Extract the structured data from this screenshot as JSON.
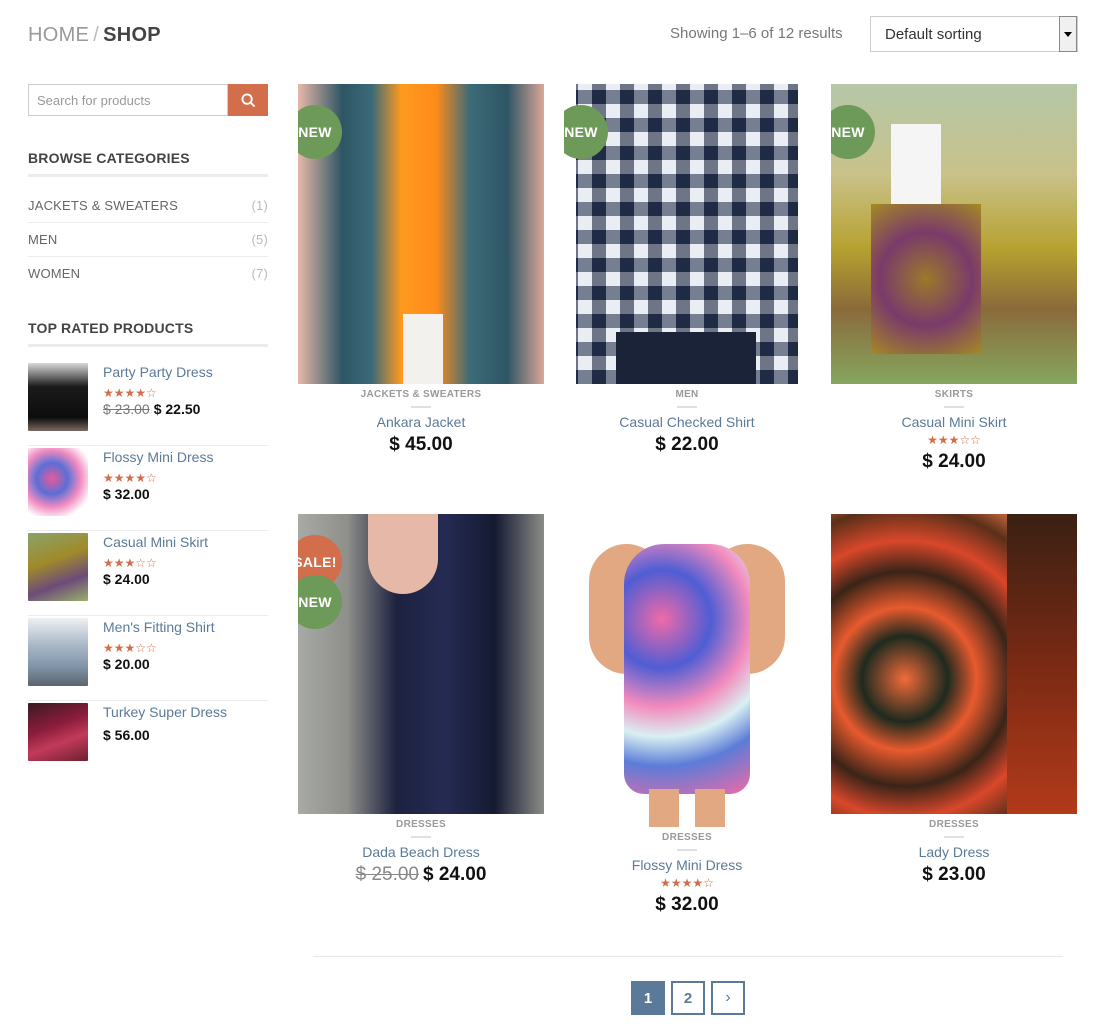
{
  "breadcrumb": {
    "home": "HOME",
    "separator": "/",
    "current": "SHOP"
  },
  "result_count": "Showing 1–6 of 12 results",
  "sorting": {
    "selected": "Default sorting"
  },
  "search": {
    "placeholder": "Search for products"
  },
  "categories": {
    "title": "BROWSE CATEGORIES",
    "items": [
      {
        "label": "JACKETS & SWEATERS",
        "count": "(1)"
      },
      {
        "label": "MEN",
        "count": "(5)"
      },
      {
        "label": "WOMEN",
        "count": "(7)"
      }
    ]
  },
  "top_rated": {
    "title": "TOP RATED PRODUCTS",
    "items": [
      {
        "name": "Party Party Dress",
        "stars": "★★★★☆",
        "rating": 4,
        "old_price": "$ 23.00",
        "price": "$ 22.50"
      },
      {
        "name": "Flossy Mini Dress",
        "stars": "★★★★☆",
        "rating": 4,
        "old_price": "",
        "price": "$ 32.00"
      },
      {
        "name": "Casual Mini Skirt",
        "stars": "★★★☆☆",
        "rating": 3,
        "old_price": "",
        "price": "$ 24.00"
      },
      {
        "name": "Men's Fitting Shirt",
        "stars": "★★★☆☆",
        "rating": 3,
        "old_price": "",
        "price": "$ 20.00"
      },
      {
        "name": "Turkey Super Dress",
        "stars": "",
        "rating": 0,
        "old_price": "",
        "price": "$ 56.00"
      }
    ]
  },
  "products": [
    {
      "category": "JACKETS & SWEATERS",
      "name": "Ankara Jacket",
      "stars": "",
      "old_price": "",
      "price": "$ 45.00",
      "badges": [
        "NEW"
      ]
    },
    {
      "category": "MEN",
      "name": "Casual Checked Shirt",
      "stars": "",
      "old_price": "",
      "price": "$ 22.00",
      "badges": [
        "NEW"
      ]
    },
    {
      "category": "SKIRTS",
      "name": "Casual Mini Skirt",
      "stars": "★★★☆☆",
      "rating": 3,
      "old_price": "",
      "price": "$ 24.00",
      "badges": [
        "NEW"
      ]
    },
    {
      "category": "DRESSES",
      "name": "Dada Beach Dress",
      "stars": "",
      "old_price": "$ 25.00",
      "price": "$ 24.00",
      "badges": [
        "SALE!",
        "NEW"
      ]
    },
    {
      "category": "DRESSES",
      "name": "Flossy Mini Dress",
      "stars": "★★★★☆",
      "rating": 4,
      "old_price": "",
      "price": "$ 32.00",
      "badges": []
    },
    {
      "category": "DRESSES",
      "name": "Lady Dress",
      "stars": "",
      "old_price": "",
      "price": "$ 23.00",
      "badges": []
    }
  ],
  "pagination": {
    "pages": [
      "1",
      "2"
    ],
    "current": "1",
    "next": "›"
  },
  "colors": {
    "accent": "#d26e4b",
    "new_badge": "#6e9a59",
    "link": "#5b7a99"
  },
  "icons": {
    "search": "search-icon",
    "sort": "chevron-down-icon"
  }
}
